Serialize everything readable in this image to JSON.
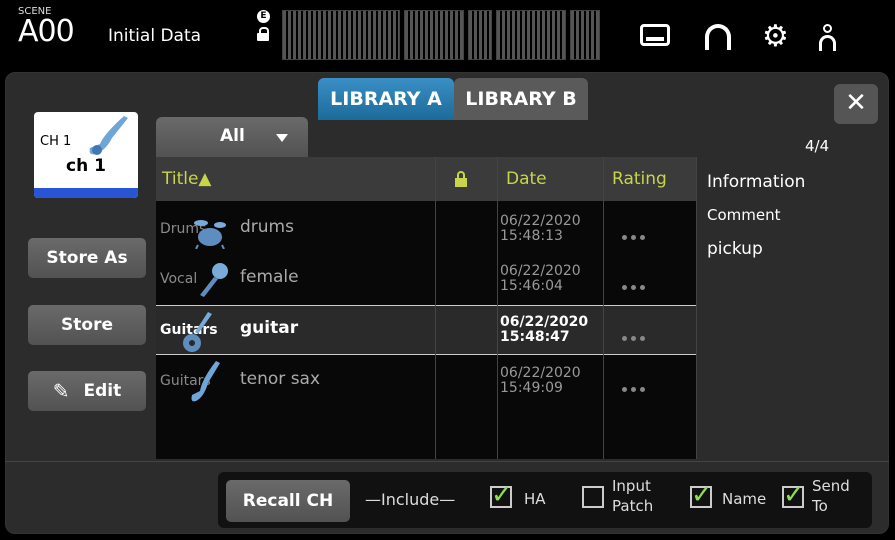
{
  "top": {
    "scene_label": "SCENE",
    "scene_number": "A00",
    "scene_title": "Initial Data",
    "e_indicator": "E",
    "icons": [
      "recorder-icon",
      "headphones-icon",
      "gear-icon",
      "user-icon"
    ]
  },
  "tabs": {
    "library_a": "LIBRARY A",
    "library_b": "LIBRARY B",
    "active": "LIBRARY A"
  },
  "close_symbol": "✕",
  "channel": {
    "number": "CH 1",
    "name": "ch 1",
    "color": "#2a54d6"
  },
  "side_buttons": {
    "store_as": "Store As",
    "store": "Store",
    "edit": "Edit"
  },
  "filter": {
    "value": "All"
  },
  "counter": "4/4",
  "table": {
    "headers": {
      "title": "Title▲",
      "date": "Date",
      "rating": "Rating"
    },
    "rows": [
      {
        "category": "Drums",
        "title": "drums",
        "date": "06/22/2020",
        "time": "15:48:13",
        "selected": false
      },
      {
        "category": "Vocal",
        "title": "female",
        "date": "06/22/2020",
        "time": "15:46:04",
        "selected": false
      },
      {
        "category": "Guitars",
        "title": "guitar",
        "date": "06/22/2020",
        "time": "15:48:47",
        "selected": true
      },
      {
        "category": "Guitars",
        "title": "tenor sax",
        "date": "06/22/2020",
        "time": "15:49:09",
        "selected": false
      }
    ]
  },
  "info": {
    "header": "Information",
    "comment_label": "Comment",
    "comment": "pickup"
  },
  "bottom": {
    "recall": "Recall CH",
    "include": "—Include—",
    "ha": "HA",
    "ha_checked": true,
    "input_patch_1": "Input",
    "input_patch_2": "Patch",
    "input_patch_checked": false,
    "name": "Name",
    "name_checked": true,
    "send_to_1": "Send",
    "send_to_2": "To",
    "send_to_checked": true
  }
}
